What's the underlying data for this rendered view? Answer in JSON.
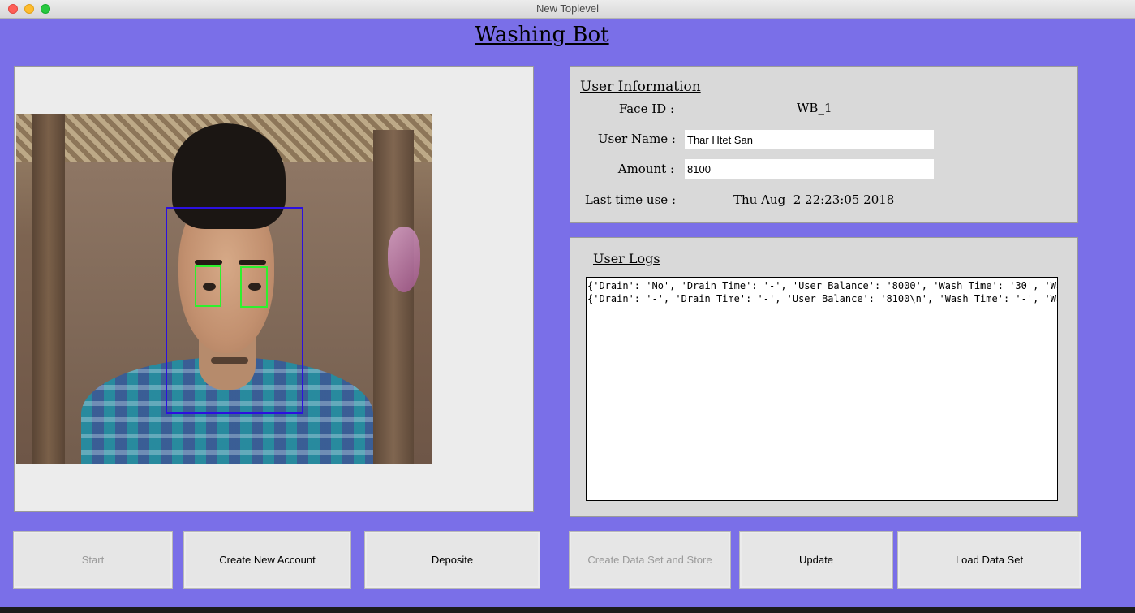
{
  "window": {
    "title": "New Toplevel"
  },
  "app": {
    "title": "Washing Bot"
  },
  "colors": {
    "background": "#7a6fe8",
    "face_box": "#2b10e0",
    "eye_box": "#2ef02e"
  },
  "user_info": {
    "heading": "User Information",
    "face_id_label": "Face ID :",
    "face_id_value": "WB_1",
    "user_name_label": "User Name :",
    "user_name_value": "Thar Htet San",
    "amount_label": "Amount :",
    "amount_value": "8100",
    "last_use_label": "Last time use :",
    "last_use_value": "Thu Aug  2 22:23:05 2018"
  },
  "user_logs": {
    "heading": "User Logs",
    "lines": [
      "{'Drain': 'No', 'Drain Time': '-', 'User Balance': '8000', 'Wash Time': '30', 'Wash",
      "{'Drain': '-', 'Drain Time': '-', 'User Balance': '8100\\n', 'Wash Time': '-', 'Wash"
    ]
  },
  "buttons": {
    "start": "Start",
    "create_account": "Create New Account",
    "deposite": "Deposite",
    "create_dataset": "Create Data Set and Store",
    "update": "Update",
    "load_dataset": "Load Data Set"
  }
}
